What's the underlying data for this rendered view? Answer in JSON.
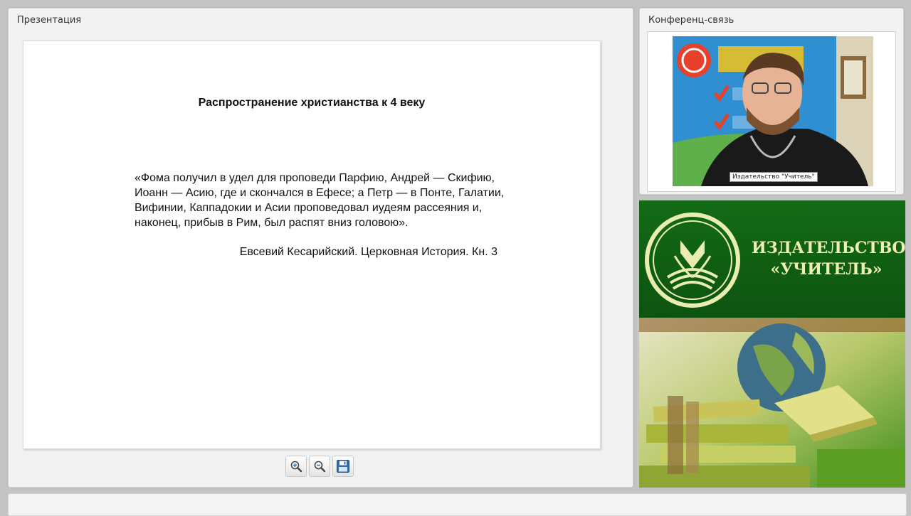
{
  "presentation": {
    "title": "Презентация",
    "slide": {
      "title": "Распространение христианства к 4 веку",
      "quote": "«Фома получил в удел для проповеди Парфию, Андрей — Скифию, Иоанн — Асию, где и скончался в Ефесе; а Петр — в Понте, Галатии, Вифинии, Каппадокии и Асии проповедовал иудеям рассеяния и, наконец, прибыв в Рим, был распят вниз головою».",
      "source": "Евсевий Кесарийский. Церковная История. Кн. 3"
    },
    "toolbar": {
      "zoom_in_icon": "zoom-in-icon",
      "zoom_out_icon": "zoom-out-icon",
      "save_icon": "floppy-disk-icon"
    }
  },
  "conference": {
    "title": "Конференц-связь",
    "video_label": "Издательство \"Учитель\""
  },
  "banner": {
    "line1": "ИЗДАТЕЛЬСТВО",
    "line2": "«УЧИТЕЛЬ»"
  },
  "colors": {
    "banner_green": "#0f5a12",
    "banner_text": "#eef0b0",
    "panel_bg": "#f2f2f2"
  }
}
